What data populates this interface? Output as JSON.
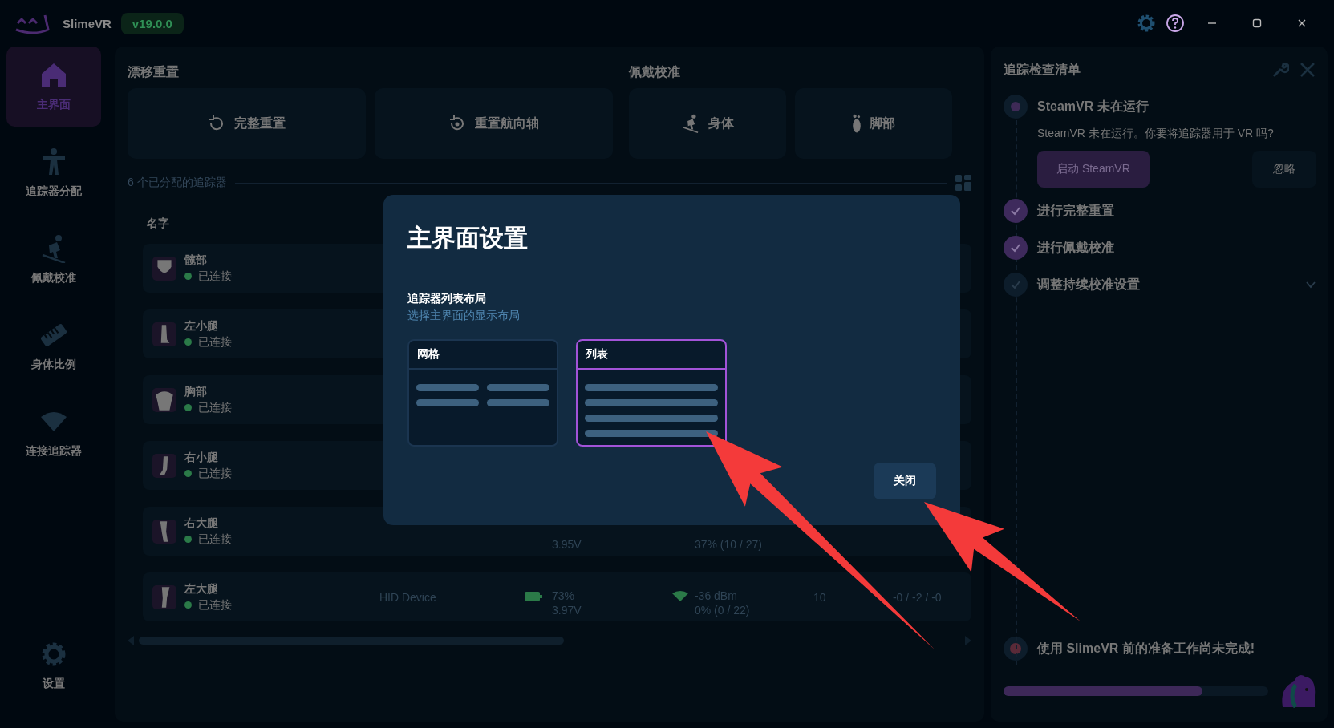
{
  "window": {
    "app_name": "SlimeVR",
    "version": "v19.0.0"
  },
  "sidebar": {
    "items": [
      {
        "kind": "home",
        "label": "主界面",
        "selected": true
      },
      {
        "kind": "assign",
        "label": "追踪器分配",
        "selected": false
      },
      {
        "kind": "mounting",
        "label": "佩戴校准",
        "selected": false
      },
      {
        "kind": "proportions",
        "label": "身体比例",
        "selected": false
      },
      {
        "kind": "connect",
        "label": "连接追踪器",
        "selected": false
      }
    ],
    "settings": {
      "label": "设置"
    }
  },
  "reset_section": {
    "title": "漂移重置",
    "buttons": [
      {
        "kind": "full",
        "label": "完整重置"
      },
      {
        "kind": "yaw",
        "label": "重置航向轴"
      }
    ]
  },
  "mounting_section": {
    "title": "佩戴校准",
    "buttons": [
      {
        "kind": "body",
        "label": "身体"
      },
      {
        "kind": "feet",
        "label": "脚部"
      }
    ]
  },
  "tracker_count": "6 个已分配的追踪器",
  "table": {
    "columns": [
      "名字"
    ],
    "rows": [
      {
        "kind": "hip",
        "name": "髋部",
        "status": "已连接"
      },
      {
        "kind": "lower-leg-left",
        "name": "左小腿",
        "status": "已连接"
      },
      {
        "kind": "chest",
        "name": "胸部",
        "status": "已连接"
      },
      {
        "kind": "lower-leg-right",
        "name": "右小腿",
        "status": "已连接"
      },
      {
        "kind": "upper-leg-right",
        "name": "右大腿",
        "status": "已连接",
        "voltage": "3.95V",
        "signal": "37% (10 / 27)"
      },
      {
        "kind": "upper-leg-left",
        "name": "左大腿",
        "status": "已连接",
        "device": "HID Device",
        "battery": "73%",
        "voltage": "3.97V",
        "rssi": "-36 dBm",
        "signal": "0% (0 / 22)",
        "tps": "10",
        "rotation": "-0 / -2 / -0"
      }
    ]
  },
  "dialog": {
    "title": "主界面设置",
    "section_title": "追踪器列表布局",
    "section_hint": "选择主界面的显示布局",
    "options": [
      {
        "kind": "grid",
        "label": "网格",
        "selected": false
      },
      {
        "kind": "list",
        "label": "列表",
        "selected": true
      }
    ],
    "close_button": "关闭"
  },
  "checklist": {
    "title": "追踪检查清单",
    "steps": [
      {
        "kind": "current",
        "label": "SteamVR 未在运行",
        "description": "SteamVR 未在运行。你要将追踪器用于 VR 吗?",
        "primary_button": "启动 SteamVR",
        "secondary_button": "忽略"
      },
      {
        "kind": "done",
        "label": "进行完整重置"
      },
      {
        "kind": "done",
        "label": "进行佩戴校准"
      },
      {
        "kind": "todo",
        "label": "调整持续校准设置",
        "expanded": false
      }
    ],
    "warning": "使用 SlimeVR 前的准备工作尚未完成!",
    "level": 0.75
  }
}
